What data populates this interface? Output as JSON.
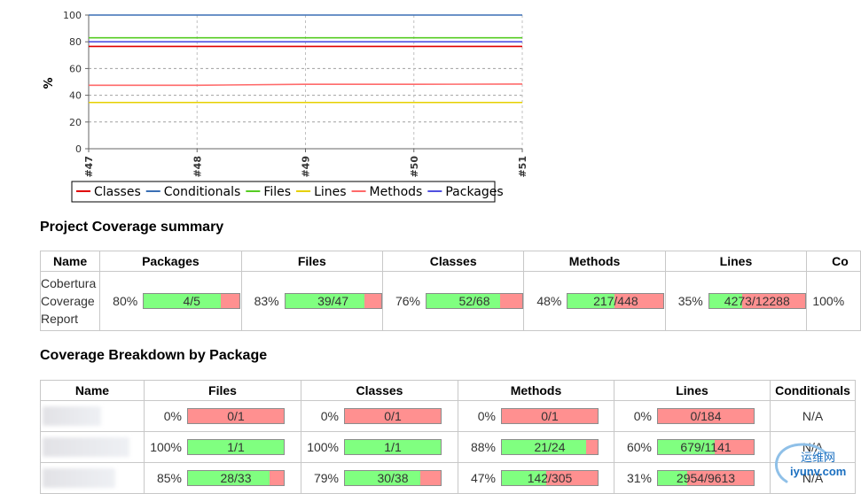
{
  "chart_data": {
    "type": "line",
    "x": [
      "#47",
      "#48",
      "#49",
      "#50",
      "#51"
    ],
    "ylabel": "%",
    "ylim": [
      0,
      100
    ],
    "yticks": [
      "0",
      "20",
      "40",
      "60",
      "80",
      "100"
    ],
    "grid": true,
    "legend_position": "bottom",
    "series": [
      {
        "name": "Classes",
        "color": "#e00000",
        "values": [
          76.5,
          76.5,
          76.5,
          76.5,
          76.5
        ]
      },
      {
        "name": "Conditionals",
        "color": "#3a6fb5",
        "values": [
          100,
          100,
          100,
          100,
          100
        ]
      },
      {
        "name": "Files",
        "color": "#55cc22",
        "values": [
          83,
          83,
          83,
          83,
          83
        ]
      },
      {
        "name": "Lines",
        "color": "#e6d000",
        "values": [
          34.6,
          34.6,
          34.6,
          34.6,
          34.6
        ]
      },
      {
        "name": "Methods",
        "color": "#ff6a6a",
        "values": [
          47.5,
          47.5,
          48.2,
          48.2,
          48.4
        ]
      },
      {
        "name": "Packages",
        "color": "#5050e0",
        "values": [
          80,
          80,
          80,
          80,
          80
        ]
      }
    ]
  },
  "summary": {
    "title": "Project Coverage summary",
    "headers": [
      "Name",
      "Packages",
      "Files",
      "Classes",
      "Methods",
      "Lines",
      "Co"
    ],
    "name_lines": [
      "Cobertura",
      "Coverage",
      "Report"
    ],
    "cells": [
      {
        "pct": "80%",
        "ratio": 0.8,
        "text": "4/5"
      },
      {
        "pct": "83%",
        "ratio": 0.83,
        "text": "39/47"
      },
      {
        "pct": "76%",
        "ratio": 0.765,
        "text": "52/68"
      },
      {
        "pct": "48%",
        "ratio": 0.484,
        "text": "217/448"
      },
      {
        "pct": "35%",
        "ratio": 0.346,
        "text": "4273/12288"
      }
    ],
    "last_cell": "100%"
  },
  "breakdown": {
    "title": "Coverage Breakdown by Package",
    "headers": [
      "Name",
      "Files",
      "Classes",
      "Methods",
      "Lines",
      "Conditionals"
    ],
    "rows": [
      {
        "cells": [
          {
            "pct": "0%",
            "ratio": 0,
            "text": "0/1"
          },
          {
            "pct": "0%",
            "ratio": 0,
            "text": "0/1"
          },
          {
            "pct": "0%",
            "ratio": 0,
            "text": "0/1"
          },
          {
            "pct": "0%",
            "ratio": 0,
            "text": "0/184"
          }
        ],
        "conditionals": "N/A"
      },
      {
        "cells": [
          {
            "pct": "100%",
            "ratio": 1,
            "text": "1/1"
          },
          {
            "pct": "100%",
            "ratio": 1,
            "text": "1/1"
          },
          {
            "pct": "88%",
            "ratio": 0.875,
            "text": "21/24"
          },
          {
            "pct": "60%",
            "ratio": 0.595,
            "text": "679/1141"
          }
        ],
        "conditionals": "N/A"
      },
      {
        "cells": [
          {
            "pct": "85%",
            "ratio": 0.848,
            "text": "28/33"
          },
          {
            "pct": "79%",
            "ratio": 0.789,
            "text": "30/38"
          },
          {
            "pct": "47%",
            "ratio": 0.466,
            "text": "142/305"
          },
          {
            "pct": "31%",
            "ratio": 0.307,
            "text": "2954/9613"
          }
        ],
        "conditionals": "N/A"
      }
    ]
  },
  "watermark": {
    "cn": "运维网",
    "en": "iyunv.com"
  }
}
